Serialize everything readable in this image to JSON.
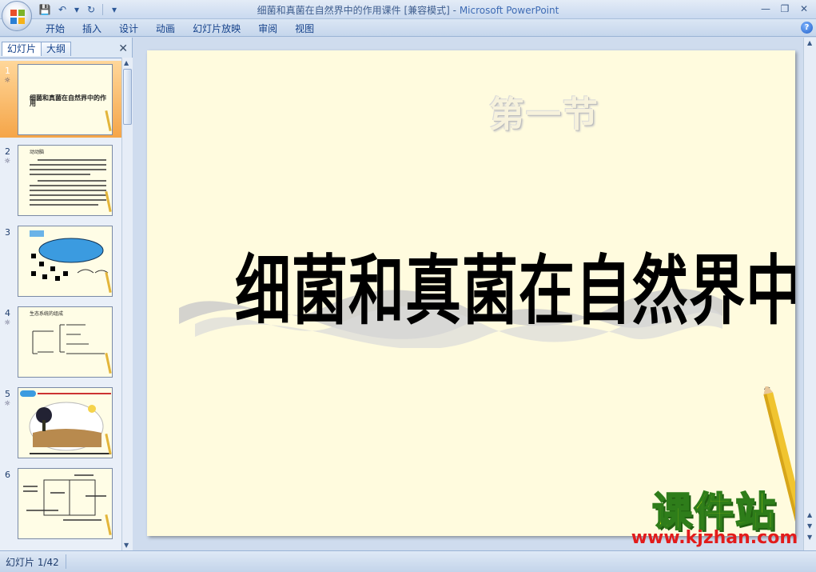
{
  "window": {
    "title": "细菌和真菌在自然界中的作用课件 [兼容模式]",
    "app_name": "Microsoft PowerPoint",
    "separator": " - "
  },
  "quick_access": [
    {
      "name": "save-icon",
      "glyph": "💾"
    },
    {
      "name": "undo-icon",
      "glyph": "↶"
    },
    {
      "name": "undo-dropdown-icon",
      "glyph": "▾"
    },
    {
      "name": "redo-icon",
      "glyph": "↻"
    },
    {
      "name": "customize-qat-icon",
      "glyph": "▾"
    }
  ],
  "window_controls": {
    "minimize": "—",
    "maximize": "❐",
    "close": "✕"
  },
  "ribbon": {
    "tabs": [
      "开始",
      "插入",
      "设计",
      "动画",
      "幻灯片放映",
      "审阅",
      "视图"
    ],
    "help": "?"
  },
  "left_pane": {
    "tab_slides": "幻灯片",
    "tab_outline": "大纲",
    "close": "✕",
    "thumbnails": [
      {
        "num": "1",
        "anim": "☼",
        "text": "细菌和真菌在自然界中的作用"
      },
      {
        "num": "2",
        "anim": "☼",
        "text": "动动脑"
      },
      {
        "num": "3",
        "anim": "",
        "text": ""
      },
      {
        "num": "4",
        "anim": "☼",
        "text": "生态系统的组成"
      },
      {
        "num": "5",
        "anim": "☼",
        "text": ""
      },
      {
        "num": "6",
        "anim": "",
        "text": ""
      }
    ]
  },
  "slide": {
    "subtitle": "第一节",
    "title": "细菌和真菌在自然界中的作用"
  },
  "watermark": {
    "big": "课件站",
    "url": "www.kjzhan.com"
  },
  "status": {
    "slide_indicator": "幻灯片 1/42"
  }
}
